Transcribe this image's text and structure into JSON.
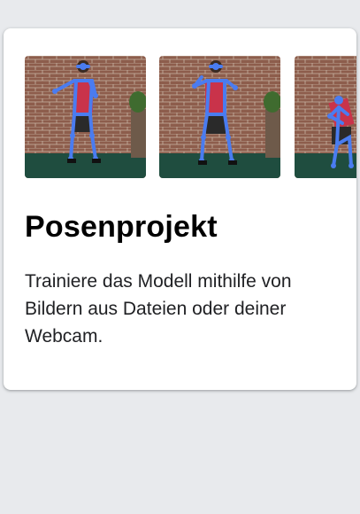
{
  "card": {
    "title": "Posenprojekt",
    "description": "Trainiere das Modell mithilfe von Bildern aus Dateien oder deiner Webcam."
  },
  "thumbnails": [
    {
      "pose": "arms-bent-standing"
    },
    {
      "pose": "arms-bent-standing-2"
    },
    {
      "pose": "leaning-partial"
    }
  ],
  "colors": {
    "page_bg": "#e8eaed",
    "card_bg": "#ffffff",
    "skeleton": "#4a7cf0",
    "brick": "#8a5a4a",
    "floor": "#1f4d3f"
  }
}
